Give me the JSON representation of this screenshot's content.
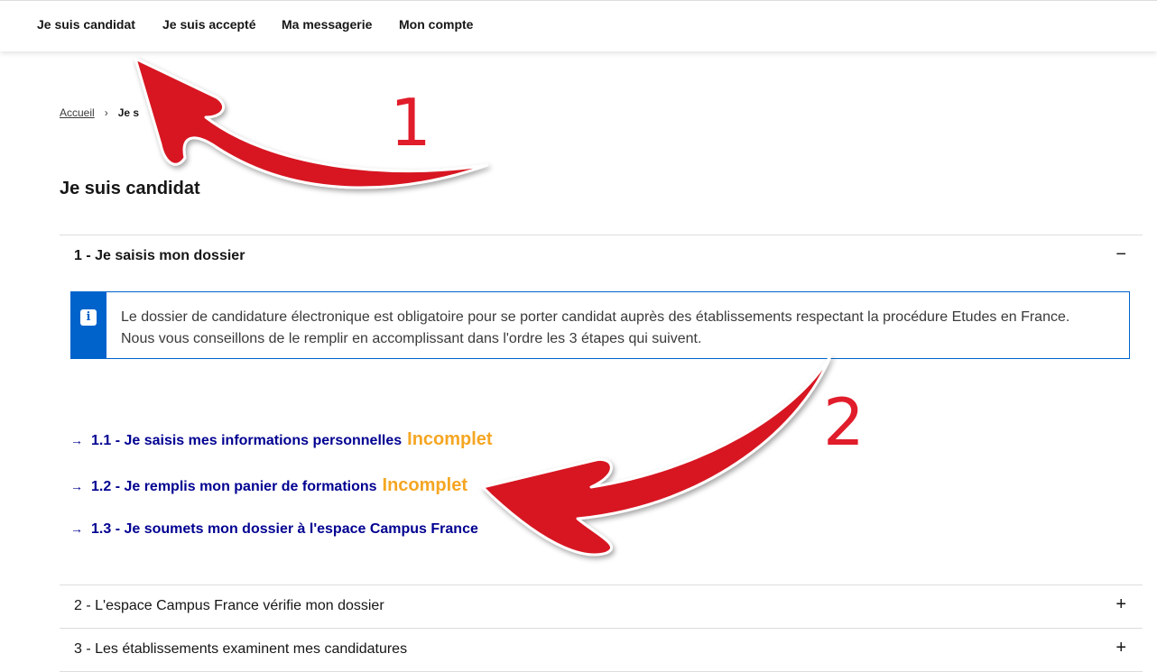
{
  "nav": {
    "items": [
      {
        "label": "Je suis candidat"
      },
      {
        "label": "Je suis accepté"
      },
      {
        "label": "Ma messagerie"
      },
      {
        "label": "Mon compte"
      }
    ]
  },
  "breadcrumb": {
    "home": "Accueil",
    "separator": "›",
    "current": "Je s"
  },
  "page": {
    "title": "Je suis candidat"
  },
  "accordion": {
    "sections": [
      {
        "label": "1 - Je saisis mon dossier",
        "toggle": "−"
      },
      {
        "label": "2 - L'espace Campus France vérifie mon dossier",
        "toggle": "+"
      },
      {
        "label": "3 - Les établissements examinent mes candidatures",
        "toggle": "+"
      }
    ]
  },
  "callout": {
    "icon": "info-icon",
    "glyph": "i",
    "text": "Le dossier de candidature électronique est obligatoire pour se porter candidat auprès des établissements respectant la procédure Etudes en France. Nous vous conseillons de le remplir en accomplissant dans l'ordre les 3 étapes qui suivent."
  },
  "steps": [
    {
      "arrow": "→",
      "label": "1.1 - Je saisis mes informations personnelles",
      "status": "Incomplet"
    },
    {
      "arrow": "→",
      "label": "1.2 - Je remplis mon panier de formations",
      "status": "Incomplet"
    },
    {
      "arrow": "→",
      "label": "1.3 - Je soumets mon dossier à l'espace Campus France",
      "status": ""
    }
  ],
  "annotations": {
    "labels": [
      "1",
      "2"
    ],
    "color": "#e11d2b"
  },
  "colors": {
    "primary_blue": "#000091",
    "info_blue": "#0063cb",
    "status_orange": "#f5a623",
    "annotation_red": "#e11d2b"
  }
}
